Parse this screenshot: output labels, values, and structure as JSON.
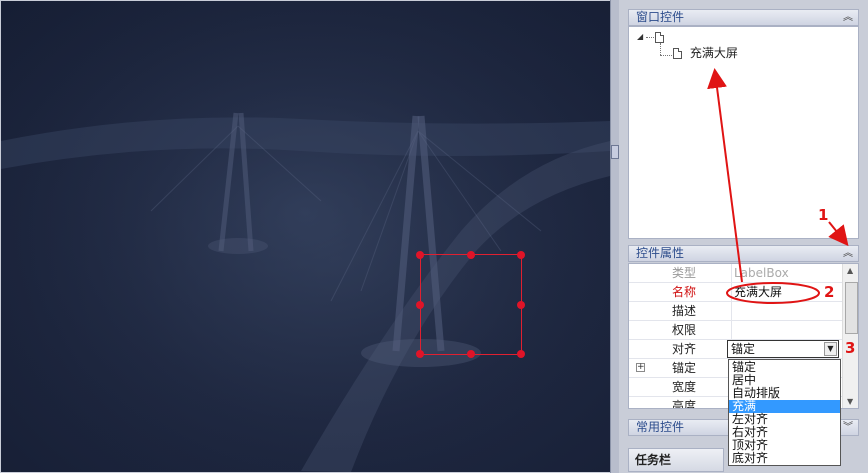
{
  "window_panel": {
    "title": "窗口控件"
  },
  "tree": {
    "child_label": "充满大屏"
  },
  "props_panel": {
    "title": "控件属性",
    "rows": [
      {
        "label": "类型",
        "value": "LabelBox"
      },
      {
        "label": "名称",
        "value": "充满大屏"
      },
      {
        "label": "描述",
        "value": ""
      },
      {
        "label": "权限",
        "value": ""
      },
      {
        "label": "对齐",
        "value": "锚定"
      },
      {
        "label": "锚定",
        "value": ""
      },
      {
        "label": "宽度",
        "value": ""
      },
      {
        "label": "高度",
        "value": ""
      }
    ]
  },
  "align_combo": {
    "value": "锚定",
    "options": [
      "锚定",
      "居中",
      "自动排版",
      "充满",
      "左对齐",
      "右对齐",
      "顶对齐",
      "底对齐"
    ],
    "selected": "充满"
  },
  "common_panel": {
    "title": "常用控件"
  },
  "taskbar": {
    "label": "任务栏"
  },
  "annotations": [
    "1",
    "2",
    "3"
  ],
  "colors": {
    "annotation": "#e01414",
    "selection": "#e02030",
    "canvas": "#1e2740",
    "highlight": "#3399ff"
  },
  "icons": [
    "collapse-icon",
    "expand-tree-icon",
    "document-icon"
  ]
}
